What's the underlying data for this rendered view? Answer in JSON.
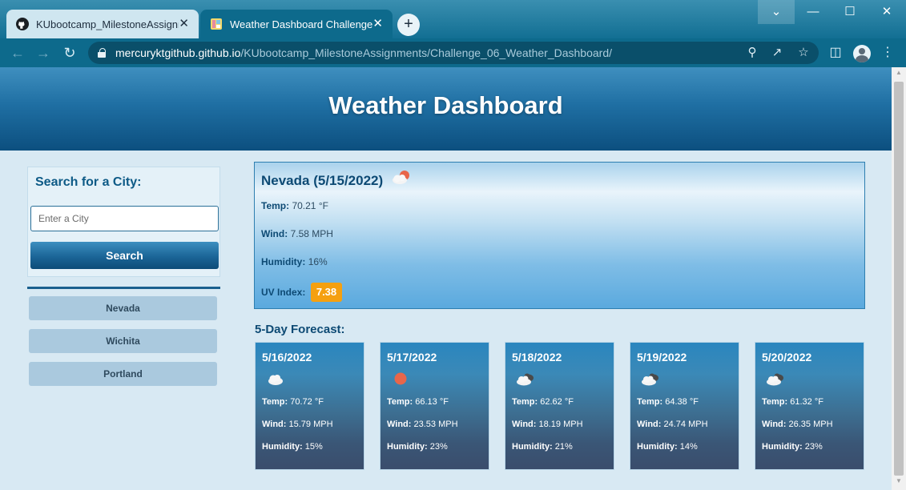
{
  "browser": {
    "tabs": [
      {
        "title": "KUbootcamp_MilestoneAssignments",
        "icon": "github-icon",
        "close": "✕"
      },
      {
        "title": "Weather Dashboard Challenge - ",
        "icon": "favicon-icon",
        "close": "✕"
      }
    ],
    "new_tab": "+",
    "window_buttons": {
      "dropdown": "⌄",
      "minimize": "—",
      "maximize": "☐",
      "close": "✕"
    },
    "url_host": "mercuryktgithub.github.io",
    "url_path": "/KUbootcamp_MilestoneAssignments/Challenge_06_Weather_Dashboard/"
  },
  "header": {
    "title": "Weather Dashboard"
  },
  "search": {
    "heading": "Search for a City:",
    "placeholder": "Enter a City",
    "button_label": "Search"
  },
  "history": [
    "Nevada",
    "Wichita",
    "Portland"
  ],
  "current": {
    "title": "Nevada (5/15/2022)",
    "icon": "partly-cloudy-day-icon",
    "temp_label": "Temp:",
    "temp": "70.21 °F",
    "wind_label": "Wind:",
    "wind": "7.58 MPH",
    "humidity_label": "Humidity:",
    "humidity": "16%",
    "uv_label": "UV Index:",
    "uv": "7.38",
    "uv_color": "#f5a010"
  },
  "forecast": {
    "heading": "5-Day Forecast:",
    "days": [
      {
        "date": "5/16/2022",
        "icon": "cloud-icon",
        "temp": "70.72 °F",
        "wind": "15.79 MPH",
        "humidity": "15%"
      },
      {
        "date": "5/17/2022",
        "icon": "sun-icon",
        "temp": "66.13 °F",
        "wind": "23.53 MPH",
        "humidity": "23%"
      },
      {
        "date": "5/18/2022",
        "icon": "cloud-dark-icon",
        "temp": "62.62 °F",
        "wind": "18.19 MPH",
        "humidity": "21%"
      },
      {
        "date": "5/19/2022",
        "icon": "cloud-dark-icon",
        "temp": "64.38 °F",
        "wind": "24.74 MPH",
        "humidity": "14%"
      },
      {
        "date": "5/20/2022",
        "icon": "cloud-dark-icon",
        "temp": "61.32 °F",
        "wind": "26.35 MPH",
        "humidity": "23%"
      }
    ],
    "labels": {
      "temp": "Temp:",
      "wind": "Wind:",
      "humidity": "Humidity:"
    }
  }
}
